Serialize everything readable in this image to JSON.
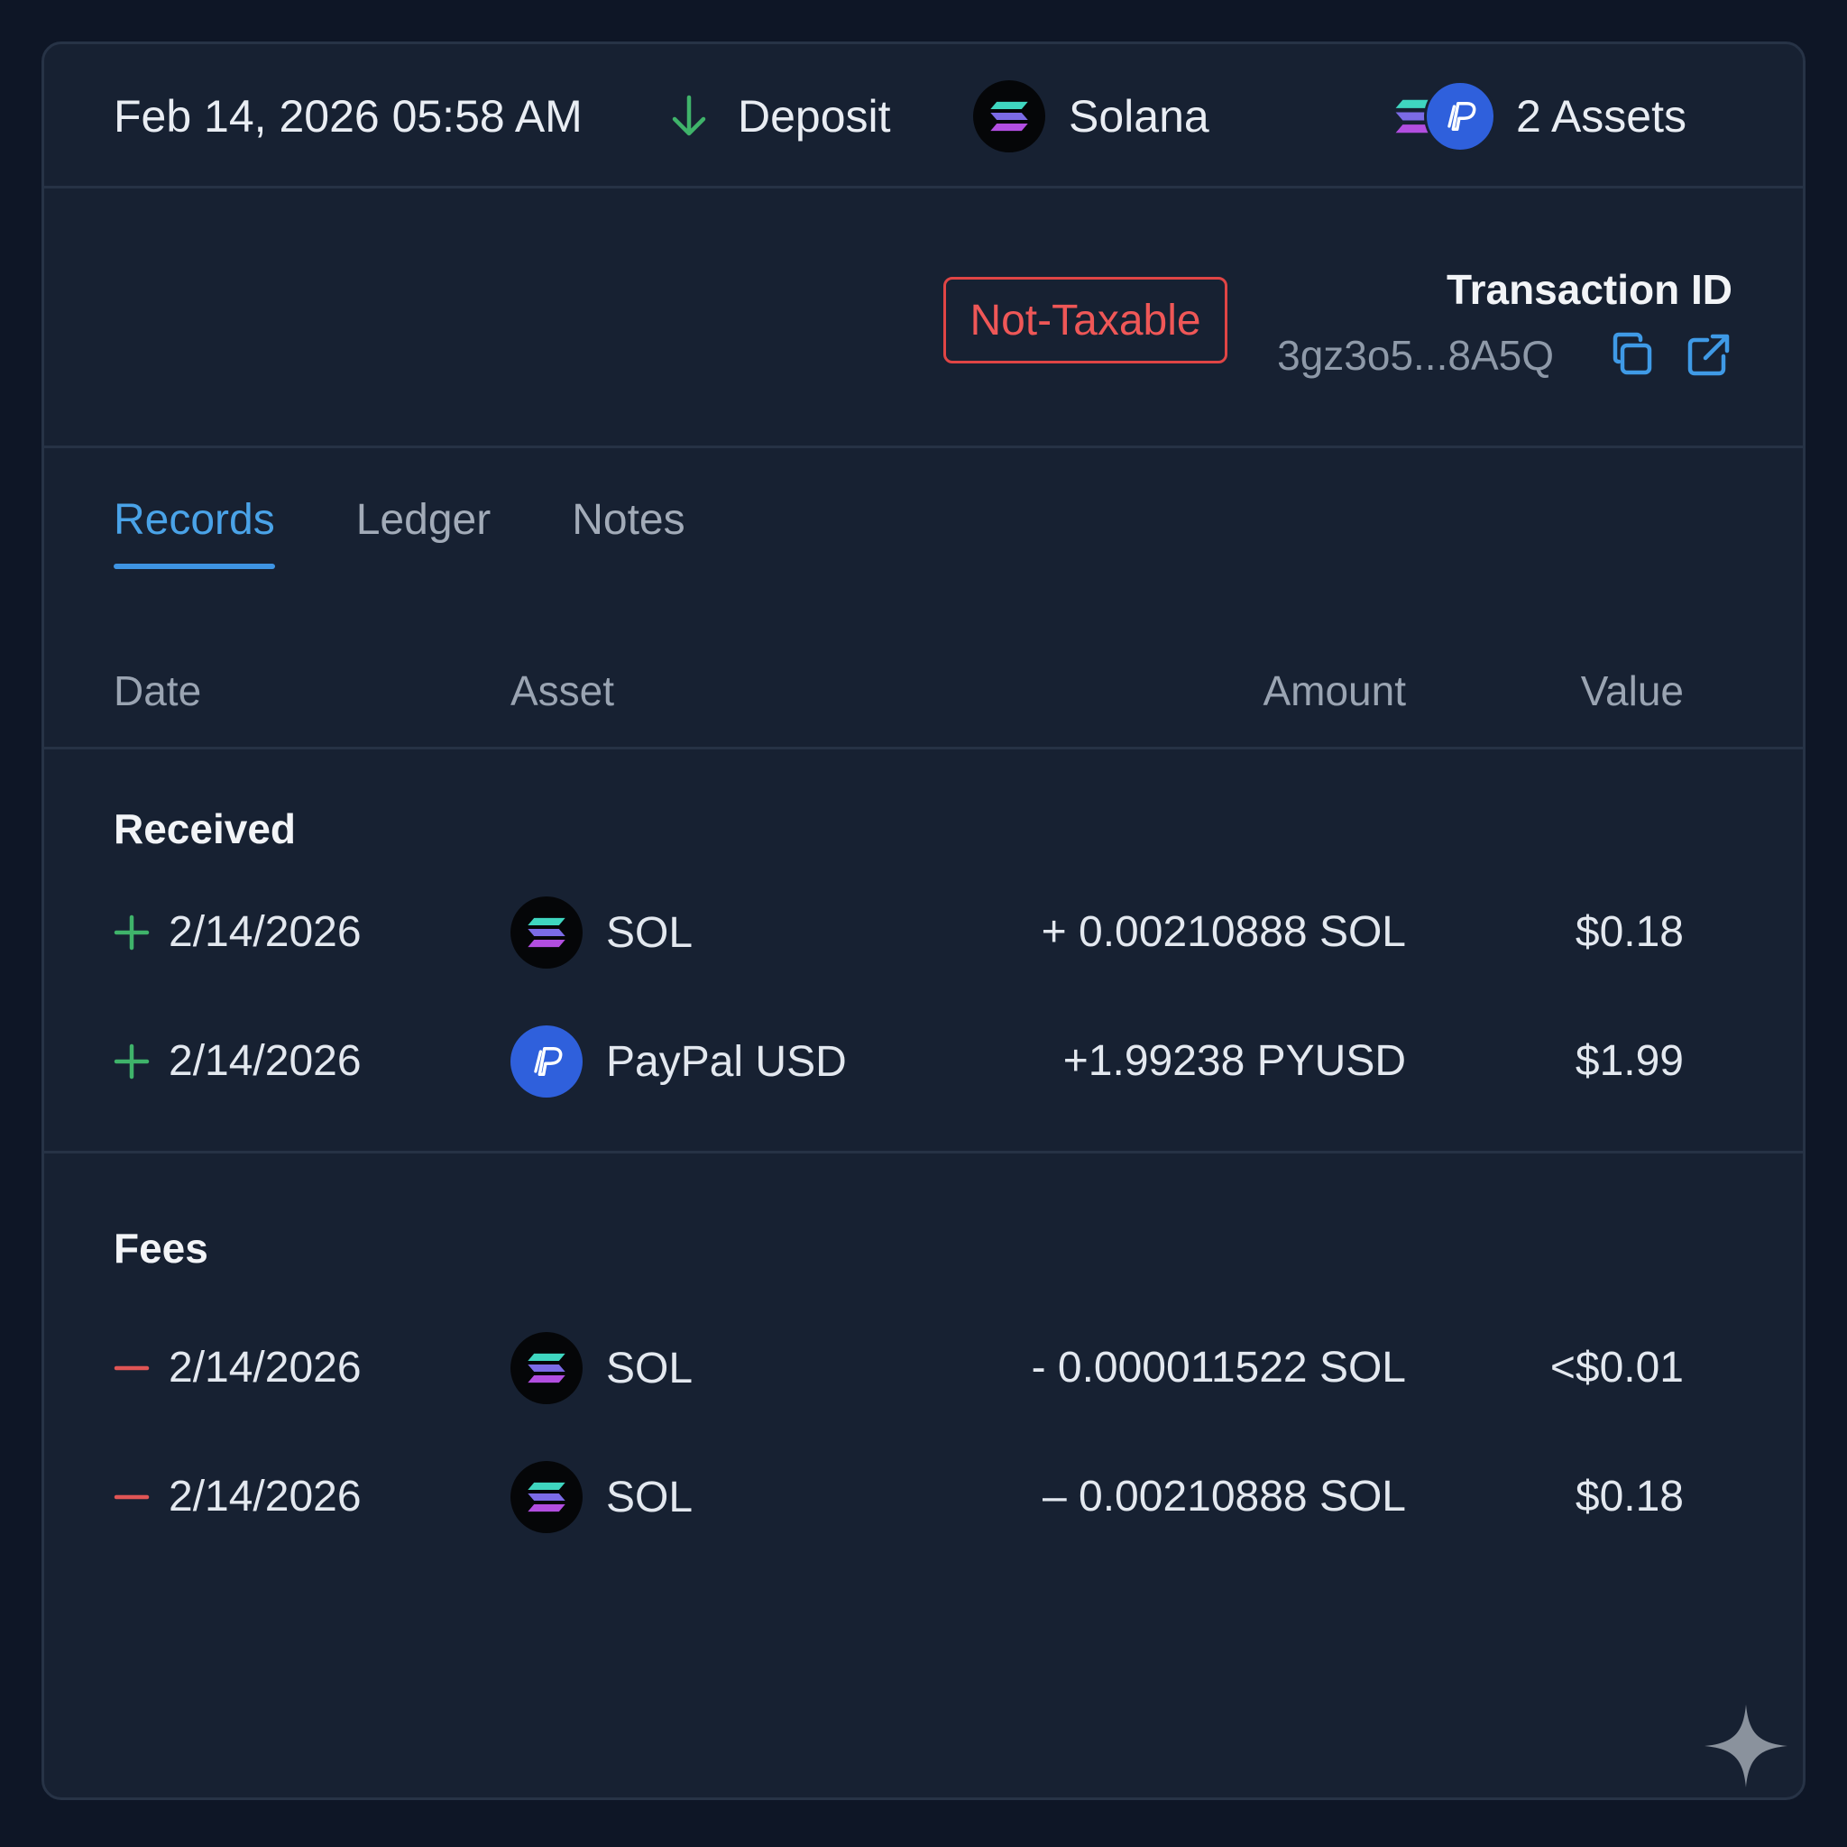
{
  "header": {
    "datetime": "Feb 14, 2026 05:58 AM",
    "type": "Deposit",
    "chain": "Solana",
    "assets_count": "2 Assets"
  },
  "transaction": {
    "status_badge": "Not-Taxable",
    "id_label": "Transaction ID",
    "id_value": "3gz3o5...8A5Q"
  },
  "tabs": [
    "Records",
    "Ledger",
    "Notes"
  ],
  "active_tab": "Records",
  "table": {
    "columns": [
      "Date",
      "Asset",
      "Amount",
      "Value"
    ]
  },
  "received": {
    "title": "Received",
    "rows": [
      {
        "date": "2/14/2026",
        "asset": "SOL",
        "amount": "+ 0.00210888 SOL",
        "value": "$0.18"
      },
      {
        "date": "2/14/2026",
        "asset": "PayPal USD",
        "amount": "+1.99238 PYUSD",
        "value": "$1.99"
      }
    ]
  },
  "fees": {
    "title": "Fees",
    "rows": [
      {
        "date": "2/14/2026",
        "asset": "SOL",
        "amount": "- 0.000011522 SOL",
        "value": "<$0.01"
      },
      {
        "date": "2/14/2026",
        "asset": "SOL",
        "amount": "– 0.00210888 SOL",
        "value": "$0.18"
      }
    ]
  },
  "colors": {
    "background": "#0e1626",
    "card": "#172132",
    "accent_blue": "#3e94e3",
    "badge_red": "#e04545",
    "positive_green": "#3fb36a",
    "negative_red": "#e05555",
    "pyusd_blue": "#2f60dc"
  }
}
